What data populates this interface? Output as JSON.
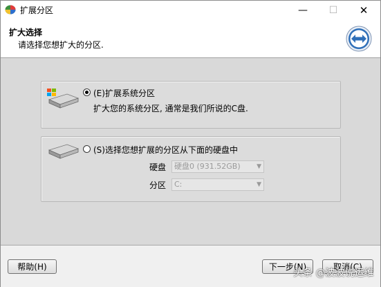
{
  "window": {
    "title": "扩展分区",
    "minimize": "—",
    "maximize": "☐",
    "close": "✕"
  },
  "header": {
    "title": "扩大选择",
    "subtitle": "请选择您想扩大的分区."
  },
  "options": {
    "system": {
      "label": "(E)扩展系统分区",
      "description": "扩大您的系统分区, 通常是我们所说的C盘.",
      "selected": true
    },
    "other": {
      "label": "(S)选择您想扩展的分区从下面的硬盘中",
      "selected": false,
      "disk_label": "硬盘",
      "disk_value": "硬盘0 (931.52GB)",
      "partition_label": "分区",
      "partition_value": "C:"
    }
  },
  "footer": {
    "help": "帮助(H)",
    "next": "下一步(N)",
    "cancel": "取消(C)"
  },
  "watermark": "头条 @波波说运维",
  "colors": {
    "content_bg": "#d9d9d9",
    "header_bg": "#ffffff",
    "logo_blue": "#2f6fb8"
  }
}
